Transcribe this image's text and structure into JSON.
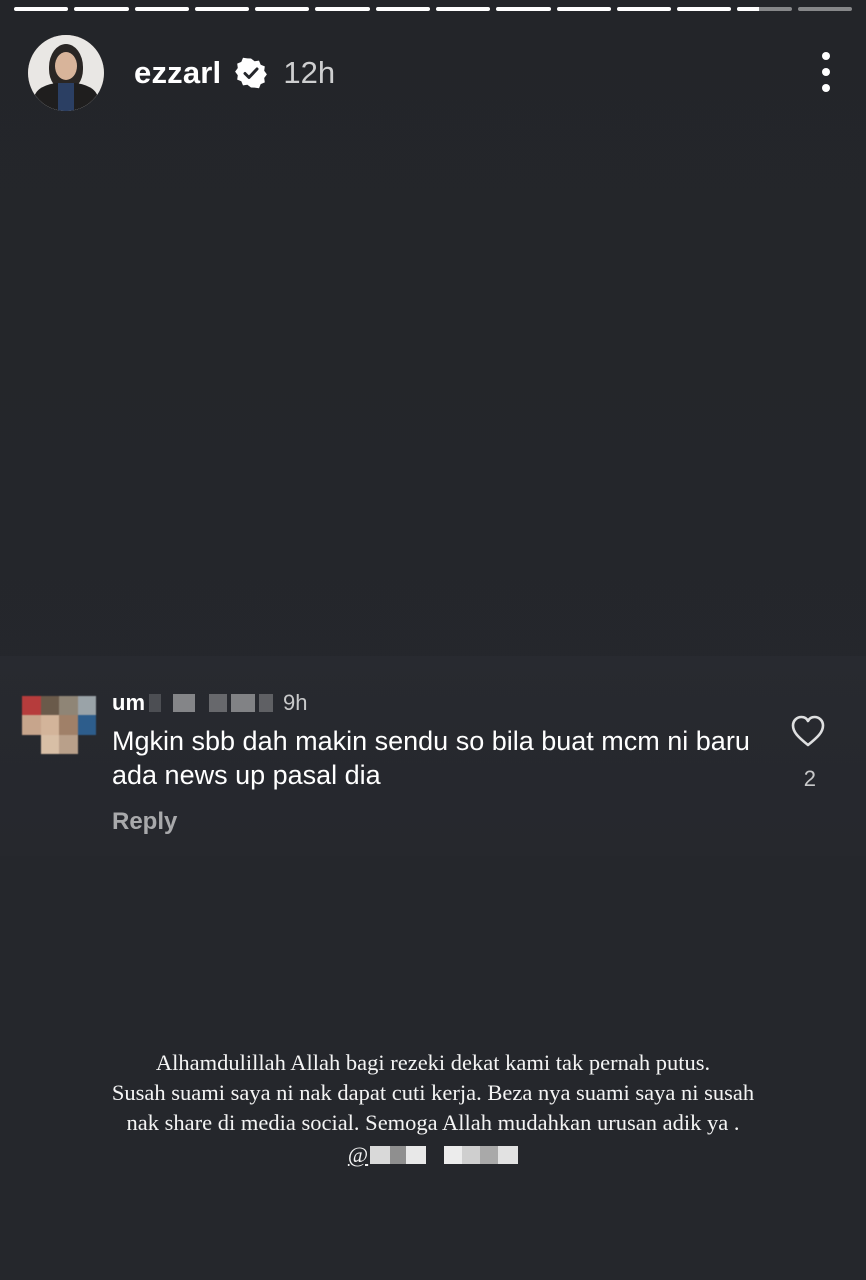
{
  "story": {
    "progress": [
      1,
      1,
      1,
      1,
      1,
      1,
      1,
      1,
      1,
      1,
      1,
      1,
      0.4,
      0
    ]
  },
  "header": {
    "username": "ezzarl",
    "time": "12h",
    "avatar_icon": "avatar-photo",
    "verified_icon": "verified-badge-icon",
    "more_icon": "more-options-icon"
  },
  "comment": {
    "username_visible": "um",
    "time": "9h",
    "text": "Mgkin sbb dah makin sendu so bila buat mcm ni baru ada news up pasal dia",
    "reply_label": "Reply",
    "like_icon": "heart-icon",
    "like_count": "2"
  },
  "caption": {
    "line1": "Alhamdulillah Allah bagi rezeki dekat kami tak pernah putus.",
    "line2": "Susah suami saya ni nak dapat cuti kerja. Beza nya suami saya ni susah",
    "line3": "nak share di media social. Semoga Allah mudahkan urusan adik ya .",
    "mention_prefix": "@"
  }
}
